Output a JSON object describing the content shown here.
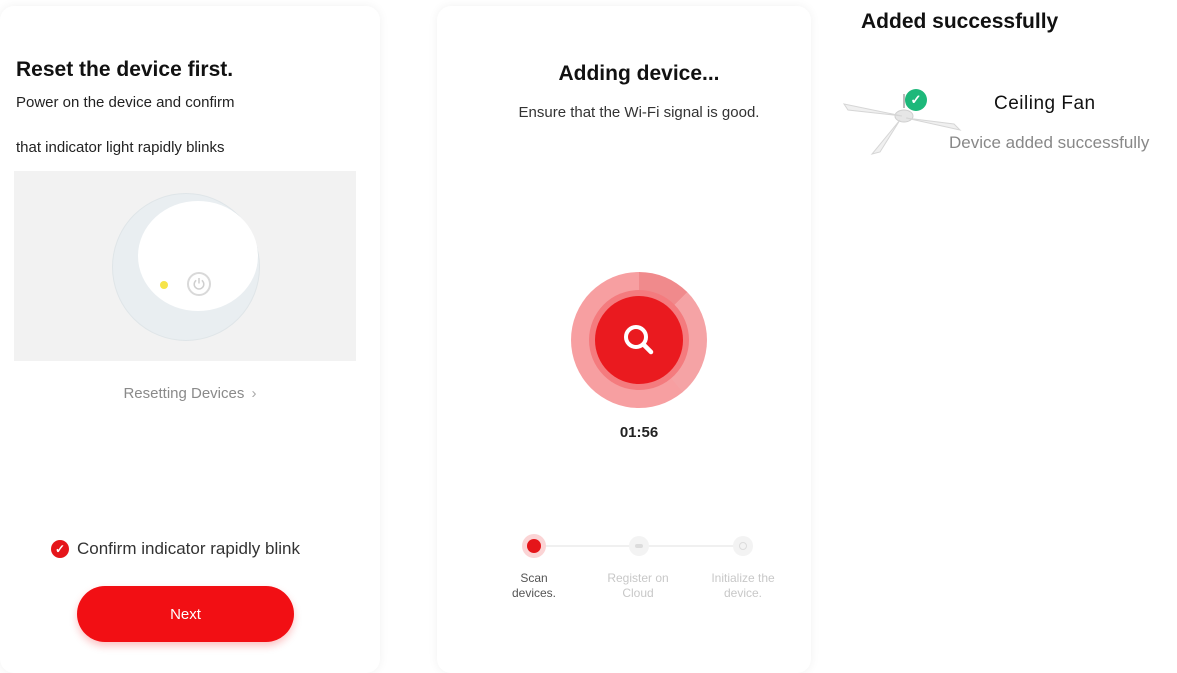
{
  "reset_panel": {
    "title": "Reset the device first.",
    "instruction_line1": "Power on the device and confirm",
    "instruction_line2": "that indicator light rapidly blinks",
    "resetting_link": "Resetting Devices",
    "confirm_label": "Confirm indicator rapidly blink",
    "confirm_checked": true,
    "next_label": "Next"
  },
  "adding_panel": {
    "title": "Adding device...",
    "subtitle": "Ensure that the Wi-Fi signal is good.",
    "timer": "01:56",
    "steps": [
      {
        "label_line1": "Scan",
        "label_line2": "devices.",
        "state": "active"
      },
      {
        "label_line1": "Register on",
        "label_line2": "Cloud",
        "state": "pending"
      },
      {
        "label_line1": "Initialize the",
        "label_line2": "device.",
        "state": "pending"
      }
    ]
  },
  "success_panel": {
    "title": "Added successfully",
    "device_name": "Ceiling Fan",
    "device_status": "Device added successfully"
  },
  "colors": {
    "accent_red": "#f20f14",
    "success_green": "#1db87a",
    "indicator_yellow": "#f6e44a"
  },
  "icons": [
    "check-icon",
    "chevron-right-icon",
    "power-icon",
    "search-icon",
    "ceiling-fan-icon"
  ]
}
